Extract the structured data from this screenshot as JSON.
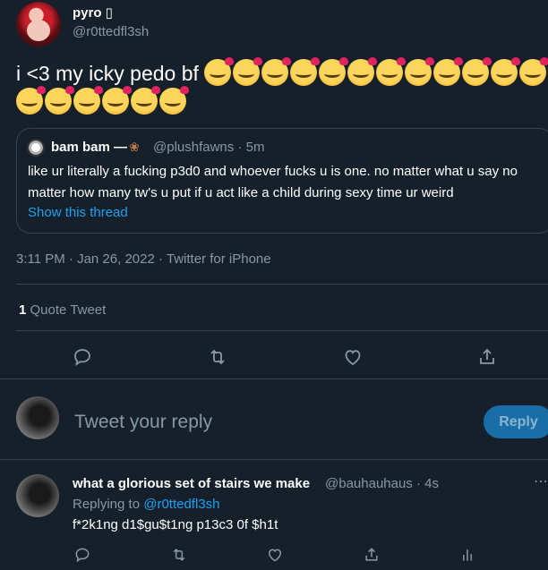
{
  "tweet": {
    "author_name": "pyro ▯",
    "author_handle": "@r0ttedfl3sh",
    "text": "i <3 my icky pedo bf",
    "emoji_icon": "smiling-face-with-hearts-icon",
    "emoji_count": 18,
    "timestamp": "3:11 PM · Jan 26, 2022 · Twitter for iPhone"
  },
  "quoted_tweet": {
    "author_name": "bam bam —",
    "author_icon": "teddy-bear-icon",
    "author_handle": "@plushfawns",
    "meta_separator": "·",
    "age": "5m",
    "text": "like ur literally a fucking p3d0 and whoever fucks u is one. no matter what u say no matter how many tw's u put if u act like a child during sexy time ur weird",
    "show_thread_label": "Show this thread"
  },
  "stats": {
    "quote_count": "1",
    "quote_label": "Quote Tweet"
  },
  "actions": [
    "reply-icon",
    "retweet-icon",
    "like-icon",
    "share-icon"
  ],
  "composer": {
    "placeholder": "Tweet your reply",
    "reply_button_label": "Reply"
  },
  "reply": {
    "author_name": "what a glorious set of stairs we make",
    "author_handle": "@bauhauhaus",
    "age": "· 4s",
    "replying_prefix": "Replying to",
    "replying_to": "@r0ttedfl3sh",
    "text": "f*2k1ng d1$gu$t1ng p13c3 0f $h1t",
    "actions": [
      "reply-icon",
      "retweet-icon",
      "like-icon",
      "share-icon",
      "analytics-icon"
    ]
  },
  "colors": {
    "background": "#15202b",
    "border": "#38444d",
    "secondary_text": "#8899a6",
    "accent": "#1da1f2"
  }
}
